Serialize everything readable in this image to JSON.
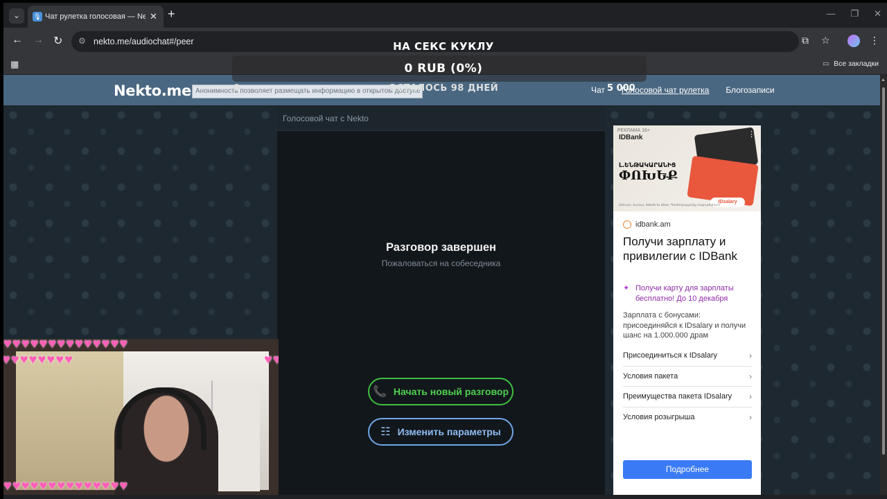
{
  "browser": {
    "tab_title": "Чат рулетка голосовая — Nekto.me",
    "url": "nekto.me/audiochat#/peer",
    "all_bookmarks": "Все закладки"
  },
  "header": {
    "logo": "Nekto.me",
    "anon_banner": "Анонимность позволяет размещать информацию в открытом доступе",
    "links": [
      "Чат",
      "Голосовой чат рулетка",
      "Блогозаписи"
    ]
  },
  "chat": {
    "head": "Голосовой чат с Nekto",
    "ended_title": "Разговор завершен",
    "complain_link": "Пожаловаться на собеседника",
    "new_chat_button": "Начать новый разговор",
    "params_button": "Изменить параметры"
  },
  "overlay": {
    "line1": "НА СЕКС КУКЛУ",
    "line2": "0 RUB (0%)",
    "line3": "ОСТАЛОСЬ 98 ДНЕЙ",
    "goal_amount": "5 000",
    "zero": "0"
  },
  "ad": {
    "tag": "РЕКЛАМА 16+",
    "brand_small": "IDBank",
    "banner_line1": "Լ․ԵՆԹԱԿԱՐԱՆԻՑ",
    "banner_line2": "ՓՈԽԵՔ",
    "banner_pill": "IDsalary",
    "banner_fine": "Անհատ. ծառայ. IDBank եւ Idram. Գործողությունը տարածվում է",
    "domain": "idbank.am",
    "headline": "Получи зарплату и привилегии с IDBank",
    "promo": "Получи карту для зарплаты бесплатно! До 10 декабря",
    "desc": "Зарплата с бонусами: присоединяйся к IDsalary и получи шанс на 1.000.000 драм",
    "list": [
      "Присоединиться к IDsalary",
      "Условия пакета",
      "Преимущества пакета IDsalary",
      "Условия розыгрыша"
    ],
    "cta": "Подробнее"
  },
  "icons": {
    "phone": "phone-icon",
    "settings": "list-settings-icon"
  },
  "colors": {
    "header_bg": "#4a6781",
    "new_chat_green": "#3fbf3f",
    "params_blue": "#6fa8e6",
    "ad_cta": "#3a7bf5"
  }
}
